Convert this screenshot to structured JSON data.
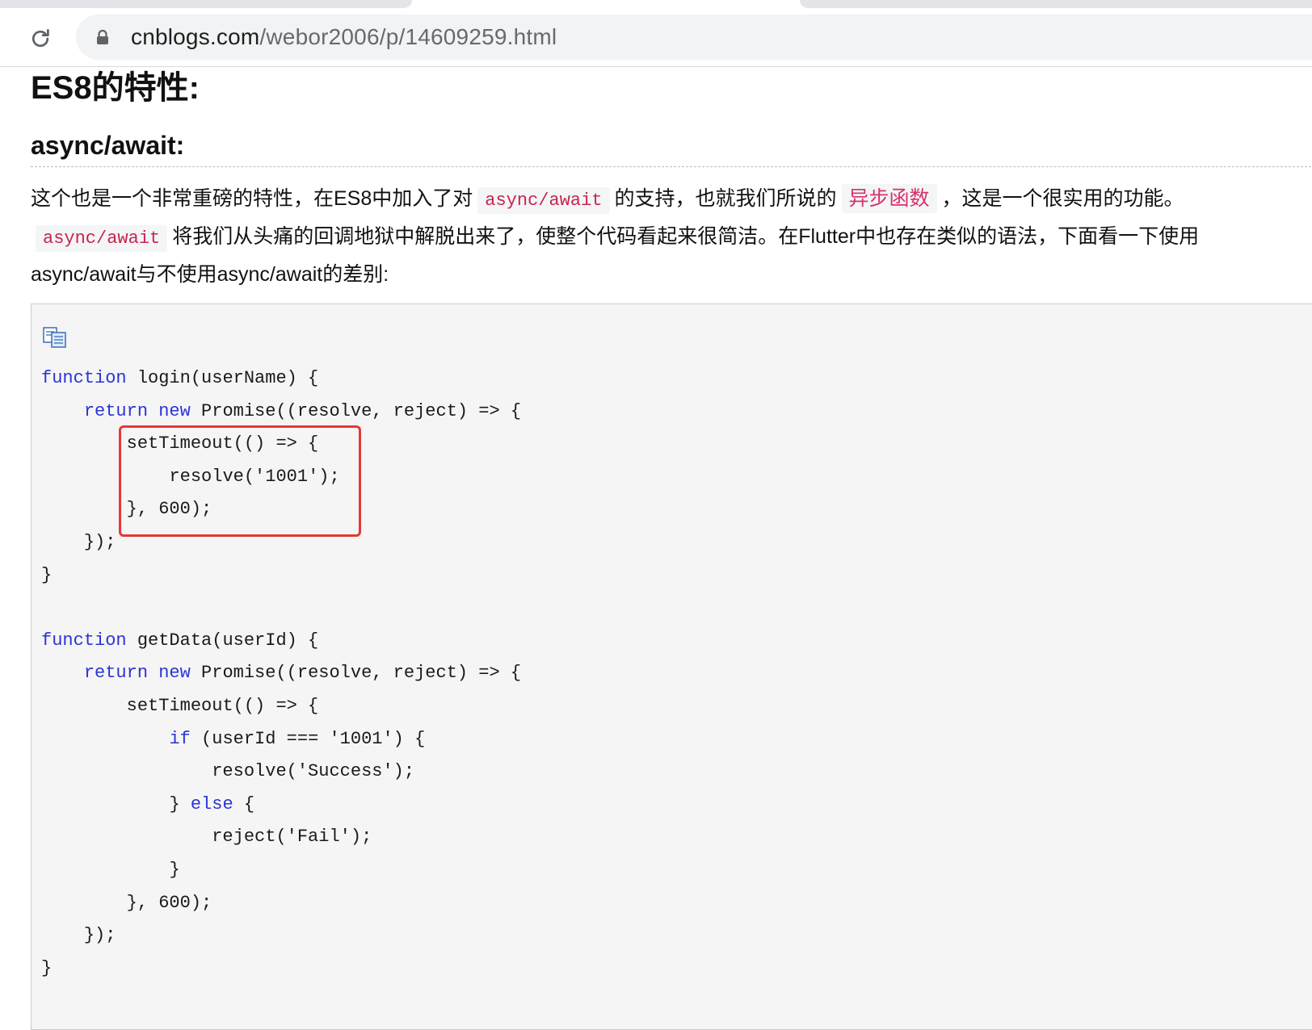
{
  "browser": {
    "url_host": "cnblogs.com",
    "url_path": "/webor2006/p/14609259.html",
    "reload_icon": "reload-icon",
    "lock_icon": "lock-icon"
  },
  "article": {
    "h1": "ES8的特性:",
    "h2": "async/await:",
    "para": {
      "p1a": "这个也是一个非常重磅的特性，在ES8中加入了对",
      "code1": "async/await",
      "p1b": "的支持，也就我们所说的",
      "hl": "异步函数",
      "p1c": "，这是一个很实用的功能。",
      "code2": "async/await",
      "p2": "将我们从头痛的回调地狱中解脱出来了，使整个代码看起来很简洁。在Flutter中也存在类似的语法，下面看一下使用",
      "p3": "async/await与不使用async/await的差别:"
    }
  },
  "code": {
    "copy_icon": "copy-code-icon",
    "lines": [
      {
        "kw": "function",
        "rest": " login(userName) {"
      },
      {
        "indent": "    ",
        "kw": "return",
        "mid": " ",
        "kw2": "new",
        "rest": " Promise((resolve, reject) => {"
      },
      {
        "indent": "        ",
        "rest": "setTimeout(() => {"
      },
      {
        "indent": "            ",
        "rest": "resolve('1001');"
      },
      {
        "indent": "        ",
        "rest": "}, 600);"
      },
      {
        "indent": "    ",
        "rest": "});"
      },
      {
        "rest": "}"
      },
      {
        "rest": ""
      },
      {
        "kw": "function",
        "rest": " getData(userId) {"
      },
      {
        "indent": "    ",
        "kw": "return",
        "mid": " ",
        "kw2": "new",
        "rest": " Promise((resolve, reject) => {"
      },
      {
        "indent": "        ",
        "rest": "setTimeout(() => {"
      },
      {
        "indent": "            ",
        "kw": "if",
        "rest": " (userId === '1001') {"
      },
      {
        "indent": "                ",
        "rest": "resolve('Success');"
      },
      {
        "indent": "            ",
        "pre": "} ",
        "kw": "else",
        "rest": " {"
      },
      {
        "indent": "                ",
        "rest": "reject('Fail');"
      },
      {
        "indent": "            ",
        "rest": "}"
      },
      {
        "indent": "        ",
        "rest": "}, 600);"
      },
      {
        "indent": "    ",
        "rest": "});"
      },
      {
        "rest": "}"
      }
    ],
    "highlight_color": "#e53935"
  }
}
